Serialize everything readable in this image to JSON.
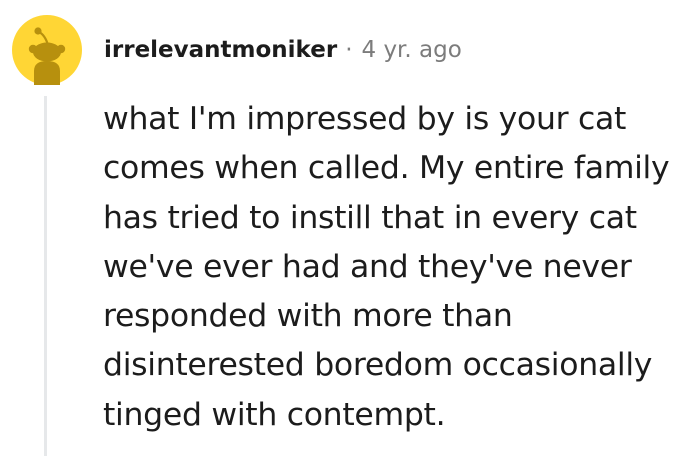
{
  "comment": {
    "author": "irrelevantmoniker",
    "separator": "·",
    "age": "4 yr. ago",
    "avatar_icon": "snoo-avatar-icon",
    "avatar_color": "#FFD635",
    "body": "what I'm impressed by is your cat comes when called. My entire family has tried to instill that in every cat we've ever had and they've never responded with more than disinterested boredom occasionally tinged with contempt."
  }
}
